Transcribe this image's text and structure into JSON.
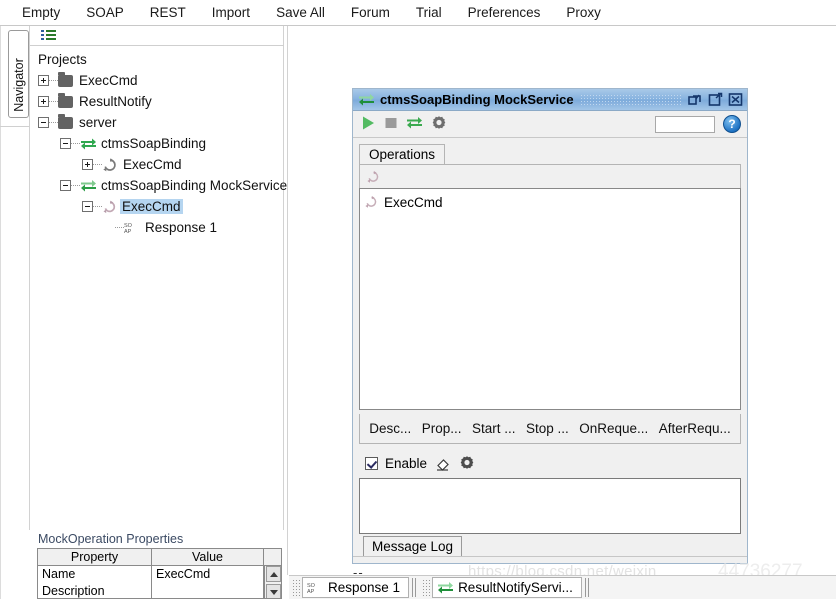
{
  "menubar": {
    "items": [
      {
        "label": "Empty",
        "name": "menu-empty"
      },
      {
        "label": "SOAP",
        "name": "menu-soap"
      },
      {
        "label": "REST",
        "name": "menu-rest"
      },
      {
        "label": "Import",
        "name": "menu-import"
      },
      {
        "label": "Save All",
        "name": "menu-save-all"
      },
      {
        "label": "Forum",
        "name": "menu-forum"
      },
      {
        "label": "Trial",
        "name": "menu-trial"
      },
      {
        "label": "Preferences",
        "name": "menu-preferences"
      },
      {
        "label": "Proxy",
        "name": "menu-proxy"
      }
    ]
  },
  "navigator": {
    "tab_label": "Navigator",
    "root_label": "Projects",
    "tree": [
      {
        "label": "ExecCmd",
        "icon": "folder-icon",
        "expander": "plus",
        "depth": 0
      },
      {
        "label": "ResultNotify",
        "icon": "folder-icon",
        "expander": "plus",
        "depth": 0
      },
      {
        "label": "server",
        "icon": "folder-icon",
        "expander": "minus",
        "depth": 0
      },
      {
        "label": "ctmsSoapBinding",
        "icon": "interface-arrows-icon",
        "expander": "minus",
        "depth": 1
      },
      {
        "label": "ExecCmd",
        "icon": "operation-refresh-icon",
        "expander": "plus",
        "depth": 2
      },
      {
        "label": "ctmsSoapBinding MockService",
        "icon": "mockservice-arrows-icon",
        "expander": "minus",
        "depth": 1
      },
      {
        "label": "ExecCmd",
        "icon": "mockoperation-icon",
        "expander": "minus",
        "depth": 2,
        "selected": true
      },
      {
        "label": "Response 1",
        "icon": "soap-response-icon",
        "expander": "none",
        "depth": 3
      }
    ]
  },
  "mock_window": {
    "title": "ctmsSoapBinding MockService",
    "title_icon": "mockservice-arrows-icon",
    "window_buttons": [
      {
        "name": "restore-icon"
      },
      {
        "name": "maximize-icon"
      },
      {
        "name": "close-icon"
      }
    ],
    "toolbar": {
      "icons": [
        {
          "name": "run-icon"
        },
        {
          "name": "stop-icon"
        },
        {
          "name": "interface-arrows-icon"
        },
        {
          "name": "options-gear-icon"
        }
      ],
      "textfield_value": "",
      "help_label": "?"
    },
    "tab": "Operations",
    "sub_toolbar_icon": "refresh-operation-icon",
    "operations": [
      {
        "label": "ExecCmd",
        "icon": "mockoperation-icon"
      }
    ],
    "bottom_tabs": [
      {
        "label": "Desc...",
        "name": "tab-description"
      },
      {
        "label": "Prop...",
        "name": "tab-properties"
      },
      {
        "label": "Start ...",
        "name": "tab-start-script"
      },
      {
        "label": "Stop ...",
        "name": "tab-stop-script"
      },
      {
        "label": "OnReque...",
        "name": "tab-onrequest-script"
      },
      {
        "label": "AfterRequ...",
        "name": "tab-afterrequest-script"
      }
    ],
    "enable": {
      "label": "Enable",
      "checked": true,
      "icons": [
        {
          "name": "clear-eraser-icon"
        },
        {
          "name": "options-gear-icon"
        }
      ]
    },
    "log_value": "",
    "message_log_tab": "Message Log",
    "status_text": "--"
  },
  "properties": {
    "title": "MockOperation Properties",
    "columns": [
      "Property",
      "Value"
    ],
    "rows": [
      {
        "property": "Name",
        "value": "ExecCmd"
      },
      {
        "property": "Description",
        "value": ""
      }
    ]
  },
  "bottom_strip": {
    "tabs": [
      {
        "label": "Response 1",
        "icon": "soap-response-icon",
        "name": "bottom-tab-response-1"
      },
      {
        "label": "ResultNotifyServi...",
        "icon": "mockservice-arrows-icon",
        "name": "bottom-tab-resultnotify-service"
      }
    ]
  },
  "watermark": {
    "text": "https://blog.csdn.net/weixin_",
    "number": "44736277"
  },
  "colors": {
    "title_blue": "#89b4e0",
    "selection_blue": "#b5d5f0",
    "green_accent": "#2fa84f",
    "panel_gray": "#f0f0f0"
  }
}
